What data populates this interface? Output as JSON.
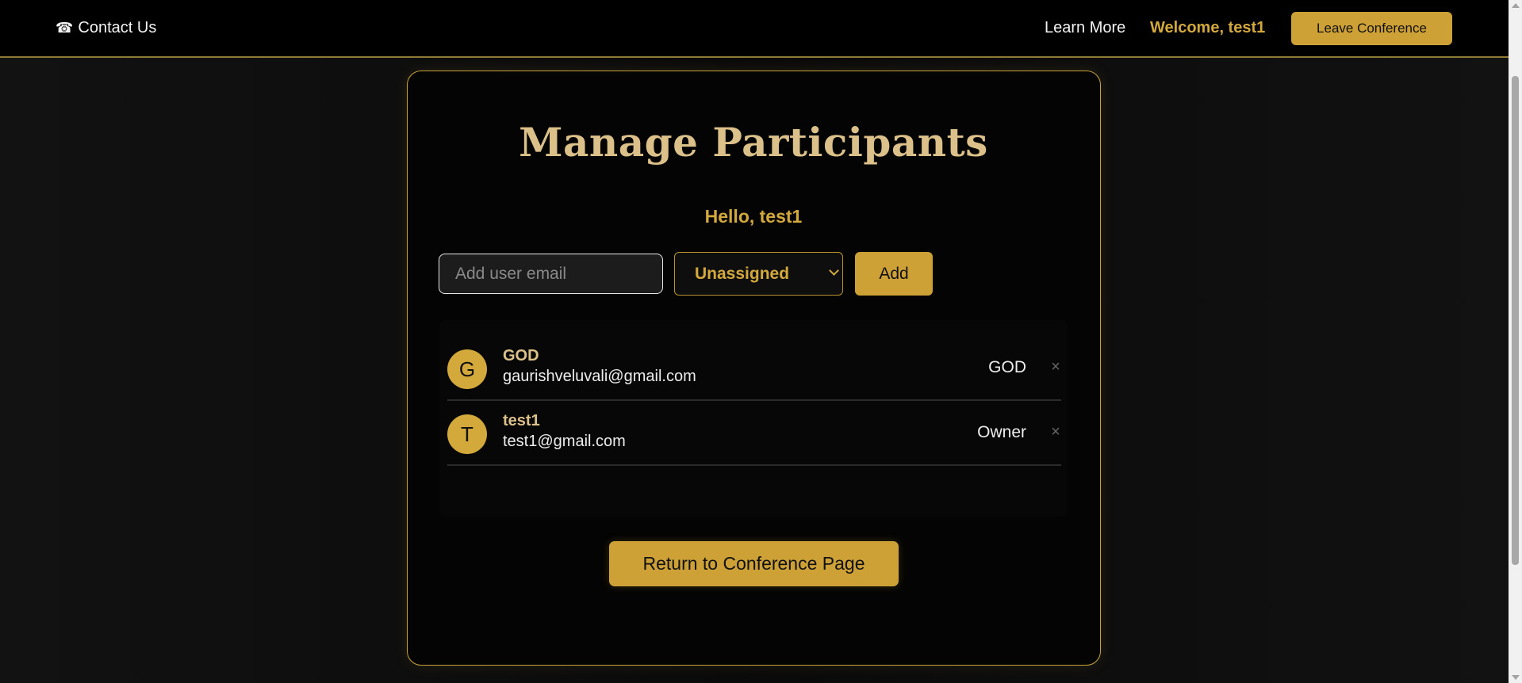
{
  "nav": {
    "contact_icon": "☎",
    "contact_label": "Contact Us",
    "learn_more": "Learn More",
    "welcome": "Welcome, test1",
    "leave_button": "Leave Conference"
  },
  "page": {
    "title": "Manage Participants",
    "greeting": "Hello, test1"
  },
  "add_form": {
    "email_placeholder": "Add user email",
    "email_value": "",
    "role_selected": "Unassigned",
    "add_button": "Add"
  },
  "participants": [
    {
      "initial": "G",
      "name": "GOD",
      "email": "gaurishveluvali@gmail.com",
      "role": "GOD",
      "remove": "×"
    },
    {
      "initial": "T",
      "name": "test1",
      "email": "test1@gmail.com",
      "role": "Owner",
      "remove": "×"
    }
  ],
  "return_button": "Return to Conference Page",
  "colors": {
    "accent": "#cda136",
    "title": "#dcc089",
    "background": "#0b0b0b"
  }
}
